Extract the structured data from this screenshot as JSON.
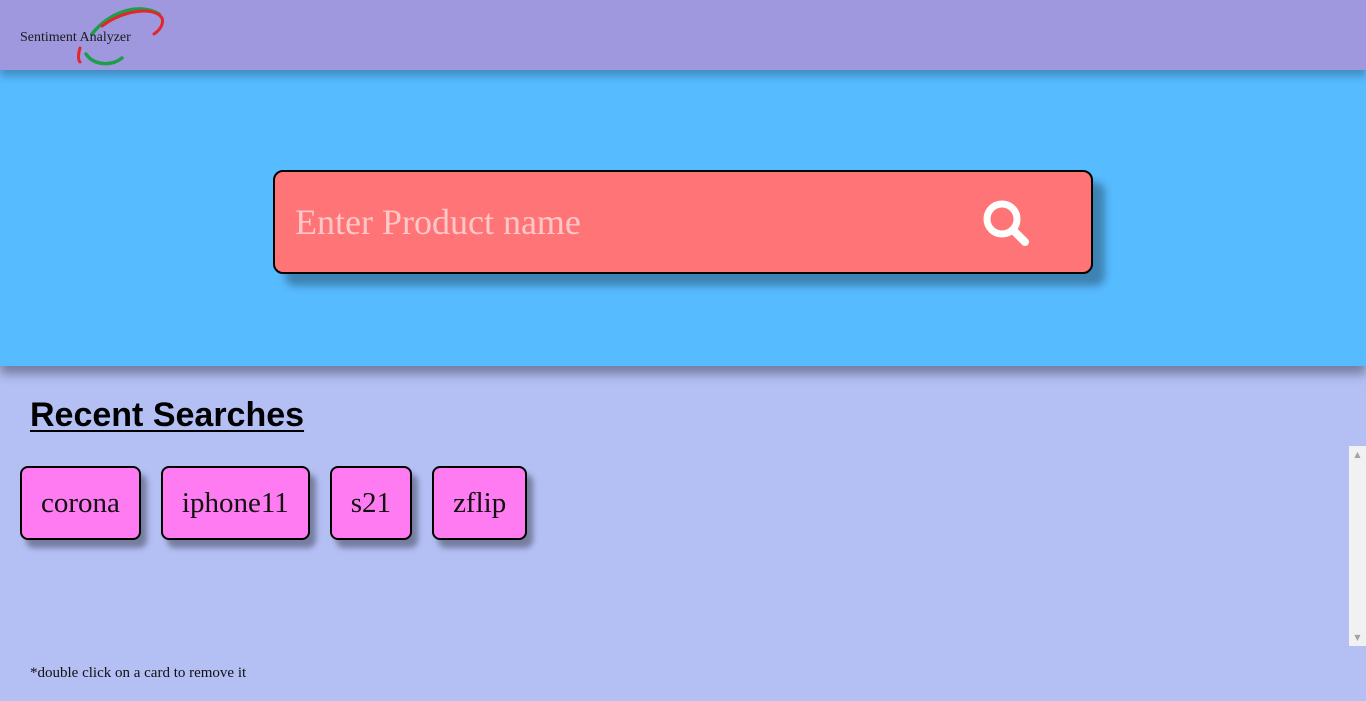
{
  "navbar": {
    "brand_text": "Sentiment Analyzer",
    "logo_colors": {
      "green": "#1e9e4a",
      "red": "#e3262b"
    },
    "background": "#a098de"
  },
  "hero": {
    "background": "#57bbff",
    "search": {
      "placeholder": "Enter Product name",
      "value": "",
      "icon": "search-icon",
      "box_color": "#ff7476"
    }
  },
  "recent": {
    "title": "Recent Searches",
    "cards": [
      {
        "label": "corona"
      },
      {
        "label": "iphone11"
      },
      {
        "label": "s21"
      },
      {
        "label": "zflip"
      }
    ],
    "card_color": "#ff7bf1",
    "hint": "*double click on a card to remove it"
  },
  "scrollbar": {
    "up_icon": "scroll-up-arrow-icon",
    "down_icon": "scroll-down-arrow-icon"
  }
}
